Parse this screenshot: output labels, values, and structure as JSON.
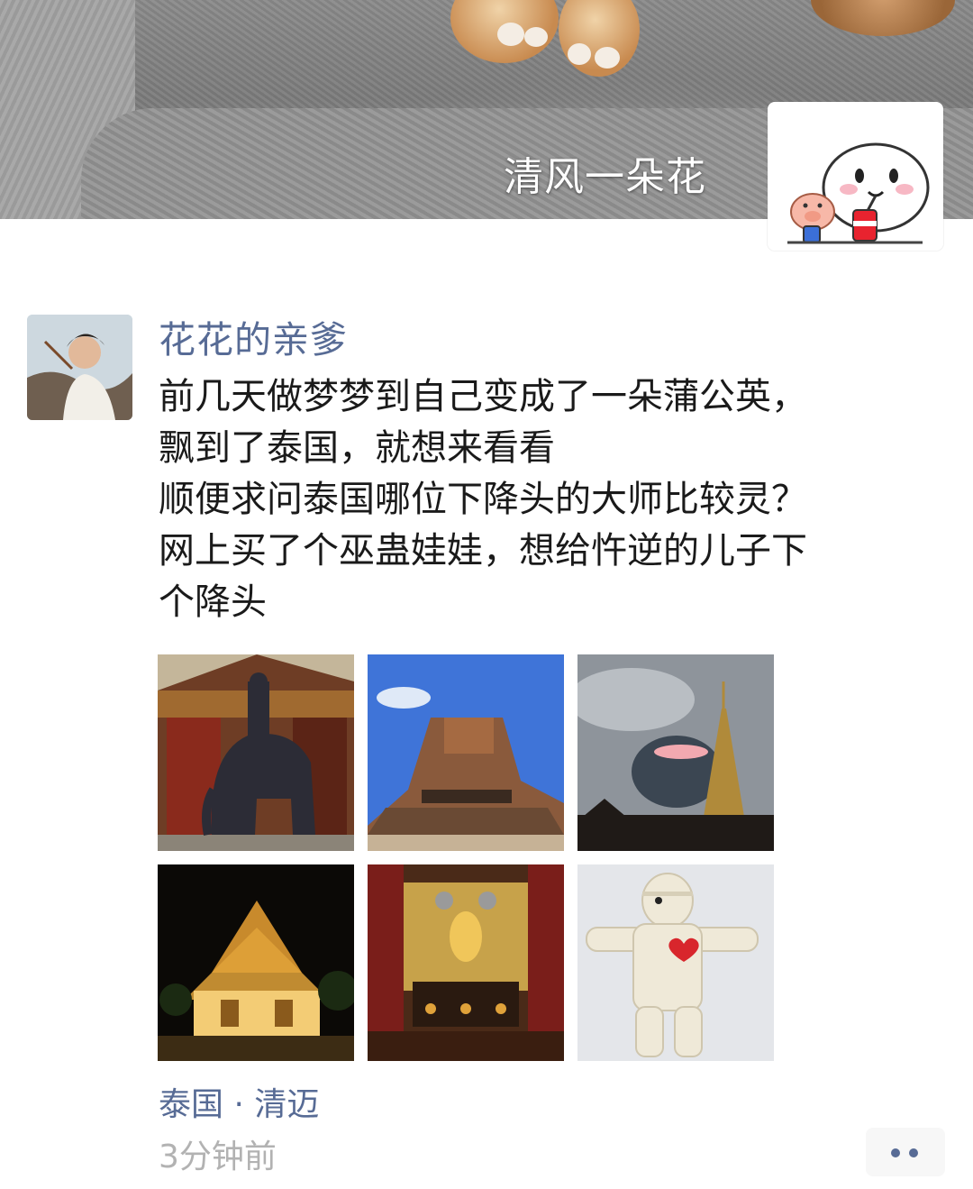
{
  "cover": {
    "name": "清风一朵花"
  },
  "post": {
    "author": "花花的亲爹",
    "text_lines": [
      "前几天做梦梦到自己变成了一朵蒲公英，",
      "飘到了泰国，就想来看看",
      "顺便求问泰国哪位下降头的大师比较灵？",
      "网上买了个巫蛊娃娃，想给忤逆的儿子下",
      "个降头"
    ],
    "images": [
      {
        "name": "elephant-statue-photo"
      },
      {
        "name": "temple-ruins-photo"
      },
      {
        "name": "cloudy-pagoda-photo"
      },
      {
        "name": "night-temple-photo"
      },
      {
        "name": "altar-photo"
      },
      {
        "name": "voodoo-doll-photo"
      }
    ],
    "location": "泰国 · 清迈",
    "time": "3分钟前"
  },
  "colors": {
    "link": "#576b95",
    "meta": "#b2b2b2",
    "text": "#1a1a1a"
  },
  "icons": {
    "more": "more-dots-icon"
  }
}
